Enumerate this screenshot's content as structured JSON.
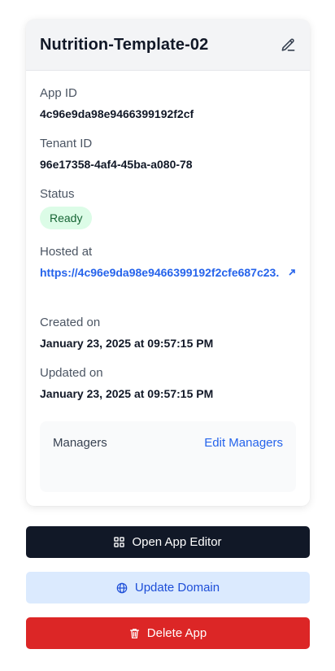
{
  "app": {
    "name": "Nutrition-Template-02"
  },
  "fields": {
    "app_id_label": "App ID",
    "app_id_value": "4c96e9da98e9466399192f2cf",
    "tenant_id_label": "Tenant ID",
    "tenant_id_value": "96e17358-4af4-45ba-a080-78",
    "status_label": "Status",
    "status_value": "Ready",
    "hosted_label": "Hosted at",
    "hosted_value": "https://4c96e9da98e9466399192f2cfe687c23.",
    "created_label": "Created on",
    "created_value": "January 23, 2025 at 09:57:15 PM",
    "updated_label": "Updated on",
    "updated_value": "January 23, 2025 at 09:57:15 PM"
  },
  "managers": {
    "label": "Managers",
    "edit_label": "Edit Managers"
  },
  "actions": {
    "open_editor": "Open App Editor",
    "update_domain": "Update Domain",
    "delete_app": "Delete App"
  },
  "colors": {
    "primary_dark": "#111827",
    "link_blue": "#2563eb",
    "status_bg": "#dcfce7",
    "danger": "#dc2626",
    "domain_bg": "#dbeafe"
  },
  "icons": {
    "edit": "pencil-square-icon",
    "editor": "grid-icon",
    "domain": "globe-icon",
    "delete": "trash-icon",
    "external": "external-link-icon"
  }
}
